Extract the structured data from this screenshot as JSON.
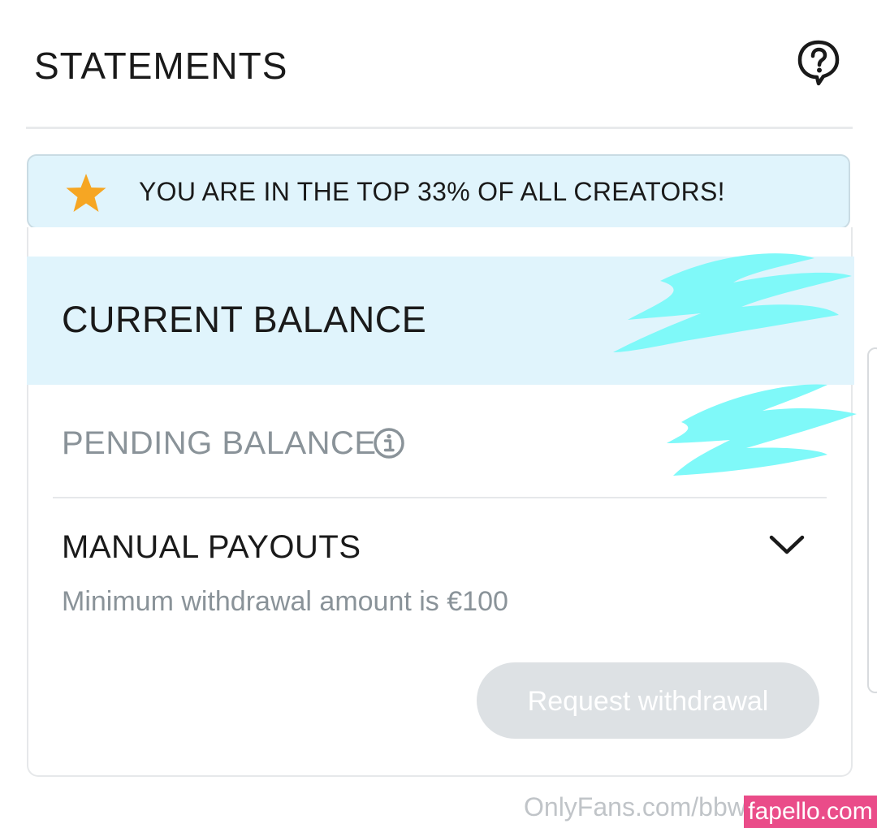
{
  "header": {
    "title": "STATEMENTS",
    "help_icon": "question-bubble-icon"
  },
  "banner": {
    "text": "YOU ARE IN THE TOP 33% OF ALL CREATORS!",
    "icon": "star-icon",
    "star_color": "#f6a623"
  },
  "balances": {
    "current_label": "CURRENT BALANCE",
    "pending_label": "PENDING BALANCE",
    "pending_info_icon": "info-icon",
    "redaction_color": "#7ff9f9"
  },
  "payouts": {
    "title": "MANUAL PAYOUTS",
    "subtitle": "Minimum withdrawal amount is €100",
    "toggle_icon": "chevron-down-icon",
    "button_label": "Request withdrawal"
  },
  "footer": {
    "url": "OnlyFans.com/bbw",
    "watermark": "fapello.com"
  },
  "colors": {
    "accent_bg": "#e0f4fc",
    "muted_text": "#8a9399",
    "disabled_button": "#dde1e4"
  }
}
